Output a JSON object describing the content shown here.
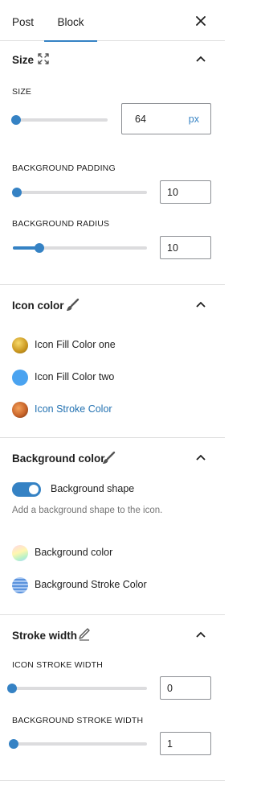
{
  "tabs": {
    "post": "Post",
    "block": "Block",
    "active": "block"
  },
  "size_panel": {
    "title": "Size",
    "icon": "resize-arrows-icon",
    "size": {
      "label": "SIZE",
      "value": "64",
      "unit": "px",
      "fraction": 0.03
    },
    "background_padding": {
      "label": "BACKGROUND PADDING",
      "value": "10",
      "fraction": 0.03
    },
    "background_radius": {
      "label": "BACKGROUND RADIUS",
      "value": "10",
      "fraction": 0.2
    }
  },
  "icon_color_panel": {
    "title": "Icon color",
    "icon": "paint-brush-icon",
    "items": [
      {
        "label": "Icon Fill Color one",
        "swatch": "gold-gradient"
      },
      {
        "label": "Icon Fill Color two",
        "swatch": "#4aa3f0"
      },
      {
        "label": "Icon Stroke Color",
        "swatch": "copper-gradient"
      }
    ]
  },
  "background_color_panel": {
    "title": "Background color",
    "icon": "paint-brush-icon",
    "toggle": {
      "label": "Background shape",
      "on": true
    },
    "help": "Add a background shape to the icon.",
    "items": [
      {
        "label": "Background color",
        "swatch": "pastel-gradient"
      },
      {
        "label": "Background Stroke Color",
        "swatch": "blue-striped"
      }
    ]
  },
  "stroke_width_panel": {
    "title": "Stroke width",
    "icon": "pencil-icon",
    "icon_stroke": {
      "label": "ICON STROKE WIDTH",
      "value": "0",
      "fraction": 0
    },
    "bg_stroke": {
      "label": "BACKGROUND STROKE WIDTH",
      "value": "1",
      "fraction": 0.01
    }
  },
  "colors": {
    "accent": "#3582c4",
    "link": "#2271b1",
    "track": "#dcdcde",
    "divider": "#e0e0e0"
  }
}
